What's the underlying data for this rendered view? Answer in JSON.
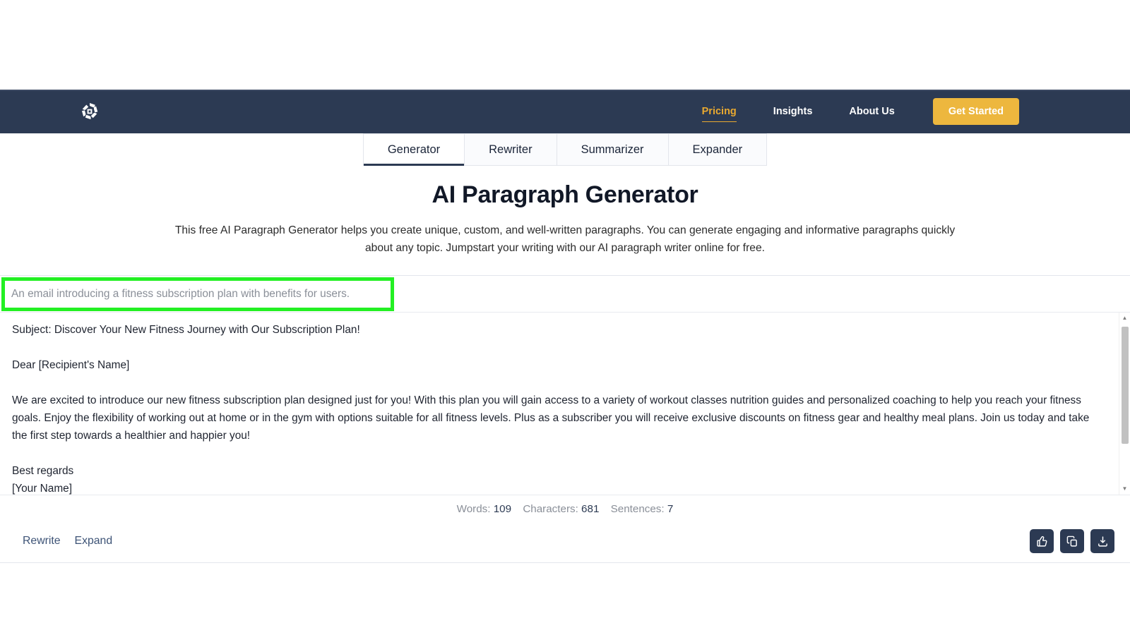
{
  "navbar": {
    "logo_icon": "pinwheel-logo-icon",
    "links": [
      {
        "label": "Pricing",
        "active": true
      },
      {
        "label": "Insights",
        "active": false
      },
      {
        "label": "About Us",
        "active": false
      }
    ],
    "cta_label": "Get Started",
    "background_color": "#2c3a53",
    "accent_color": "#e9a930",
    "cta_color": "#edb73e"
  },
  "tabs": [
    {
      "label": "Generator",
      "active": true
    },
    {
      "label": "Rewriter",
      "active": false
    },
    {
      "label": "Summarizer",
      "active": false
    },
    {
      "label": "Expander",
      "active": false
    }
  ],
  "hero": {
    "title": "AI Paragraph Generator",
    "description": "This free AI Paragraph Generator helps you create unique, custom, and well-written paragraphs. You can generate engaging and informative paragraphs quickly about any topic. Jumpstart your writing with our AI paragraph writer online for free."
  },
  "prompt": {
    "value": "An email introducing a fitness subscription plan with benefits for users.",
    "placeholder": "An email introducing a fitness subscription plan with benefits for users.",
    "highlight_color": "#23f023"
  },
  "result": {
    "subject_line": "Subject: Discover Your New Fitness Journey with Our Subscription Plan!",
    "salutation": "Dear [Recipient's Name]",
    "body": "We are excited to introduce our new fitness subscription plan designed just for you! With this plan you will gain access to a variety of workout classes nutrition guides and personalized coaching to help you reach your fitness goals. Enjoy the flexibility of working out at home or in the gym with options suitable for all fitness levels. Plus as a subscriber you will receive exclusive discounts on fitness gear and healthy meal plans. Join us today and take the first step towards a healthier and happier you!",
    "closing": "Best regards",
    "signature": "[Your Name]"
  },
  "stats": {
    "words_label": "Words:",
    "words_value": "109",
    "characters_label": "Characters:",
    "characters_value": "681",
    "sentences_label": "Sentences:",
    "sentences_value": "7"
  },
  "footer": {
    "rewrite_label": "Rewrite",
    "expand_label": "Expand",
    "icons": [
      {
        "name": "thumbs-up-icon"
      },
      {
        "name": "copy-icon"
      },
      {
        "name": "download-icon"
      }
    ]
  }
}
